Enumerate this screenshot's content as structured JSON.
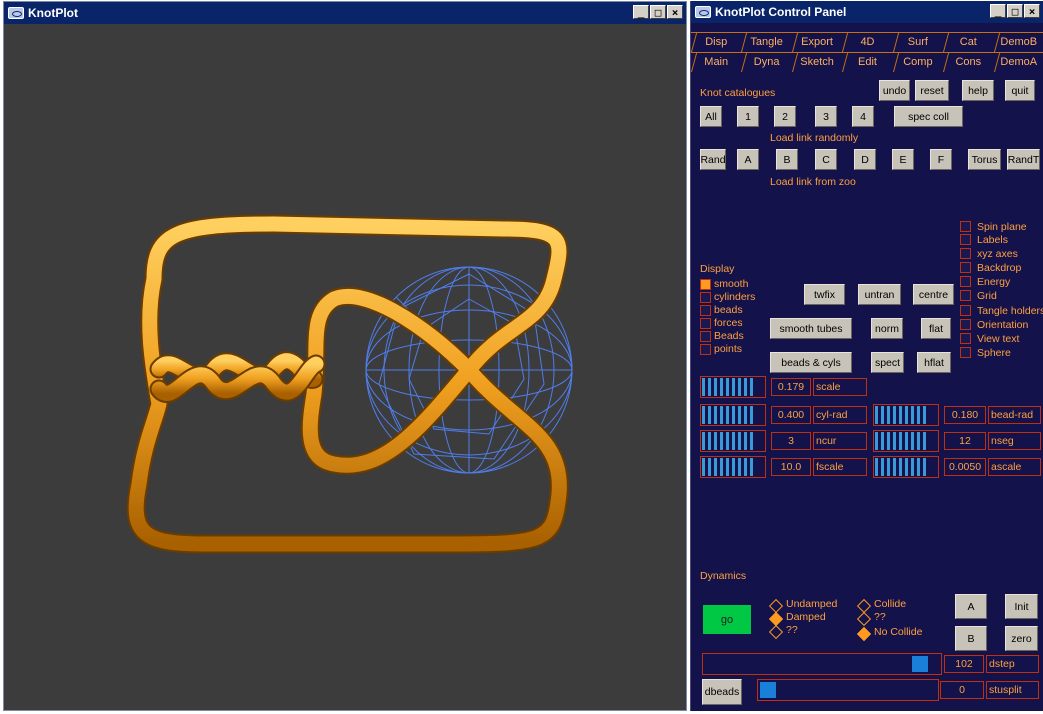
{
  "viewer": {
    "title": "KnotPlot",
    "buttons": [
      "_",
      "□",
      "X"
    ]
  },
  "panel": {
    "title": "KnotPlot Control Panel",
    "tabs_top": [
      "Disp",
      "Tangle",
      "Export",
      "4D",
      "Surf",
      "Cat",
      "DemoB"
    ],
    "tabs_bottom": [
      "Main",
      "Dyna",
      "Sketch",
      "Edit",
      "Comp",
      "Cons",
      "DemoA"
    ],
    "knot_catalogues": "Knot catalogues",
    "top_buttons": [
      "undo",
      "reset",
      "help",
      "quit"
    ],
    "catalogue_buttons": [
      "All",
      "1",
      "2",
      "3",
      "4",
      "spec coll"
    ],
    "load_random": "Load link randomly",
    "random_buttons": [
      "Rand",
      "A",
      "B",
      "C",
      "D",
      "E",
      "F",
      "Torus",
      "RandT"
    ],
    "load_zoo": "Load link from zoo",
    "display_label": "Display",
    "display_options": [
      {
        "label": "smooth",
        "checked": true
      },
      {
        "label": "cylinders",
        "checked": false
      },
      {
        "label": "beads",
        "checked": false
      },
      {
        "label": "forces",
        "checked": false
      },
      {
        "label": "Beads",
        "checked": false
      },
      {
        "label": "points",
        "checked": false
      }
    ],
    "right_options": [
      "Spin plane",
      "Labels",
      "xyz axes",
      "Backdrop",
      "Energy",
      "Grid",
      "Tangle holders",
      "Orientation",
      "View text",
      "Sphere"
    ],
    "mid_buttons": [
      "twfix",
      "untran",
      "centre",
      "smooth tubes",
      "norm",
      "flat",
      "beads & cyls",
      "spect",
      "hflat"
    ],
    "sliders": [
      {
        "value": "0.179",
        "name": "scale"
      },
      {
        "value": "0.400",
        "name": "cyl-rad"
      },
      {
        "value": "0.180",
        "name": "bead-rad"
      },
      {
        "value": "3",
        "name": "ncur"
      },
      {
        "value": "12",
        "name": "nseg"
      },
      {
        "value": "10.0",
        "name": "fscale"
      },
      {
        "value": "0.0050",
        "name": "ascale"
      }
    ],
    "dynamics_label": "Dynamics",
    "go_label": "go",
    "damping": [
      {
        "label": "Undamped",
        "selected": false
      },
      {
        "label": "Damped",
        "selected": true
      },
      {
        "label": "??",
        "selected": false
      }
    ],
    "collide": [
      {
        "label": "Collide",
        "selected": false
      },
      {
        "label": "??",
        "selected": false
      },
      {
        "label": "No Collide",
        "selected": true
      }
    ],
    "dyn_buttons": [
      "A",
      "Init",
      "B",
      "zero"
    ],
    "dstep": {
      "value": "102",
      "name": "dstep",
      "level": 0.96
    },
    "stusplit": {
      "value": "0",
      "name": "stusplit",
      "level": 0.0
    },
    "dbeads_label": "dbeads"
  },
  "colors": {
    "accent": "#ffa040",
    "panel_bg": "#13124a",
    "knot": "#f0a020",
    "sphere": "#4f7de8",
    "viewport_bg": "#3c3c3c",
    "go": "#00c844"
  }
}
